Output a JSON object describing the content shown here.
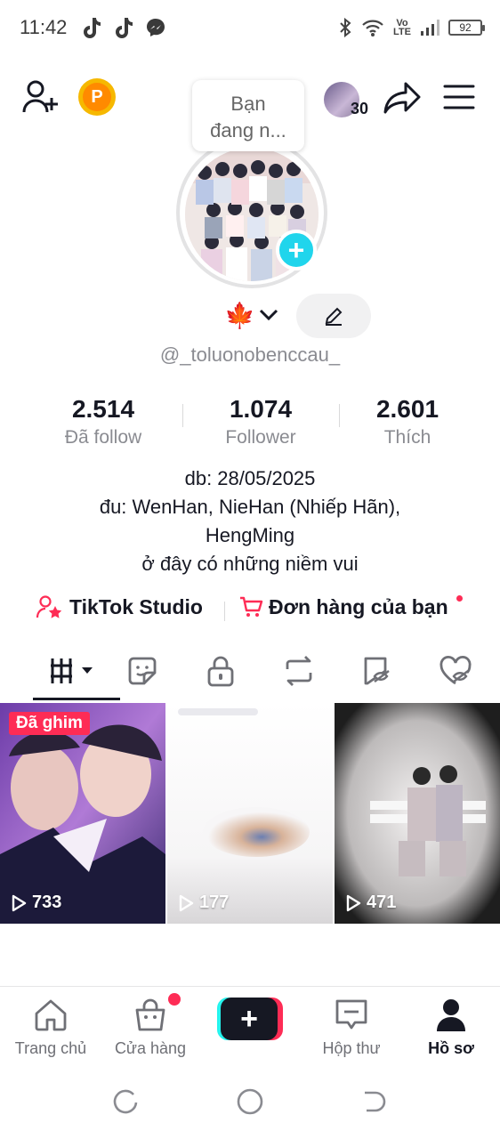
{
  "status_bar": {
    "time": "11:42",
    "left_icons": [
      "tiktok-icon",
      "tiktok-icon",
      "messenger-icon"
    ],
    "right_icons": [
      "bluetooth-icon",
      "wifi-icon",
      "volte-icon",
      "signal-icon"
    ],
    "volte_text": "Vo\nLTE",
    "battery": "92"
  },
  "header": {
    "tooltip": "Bạn\nđang n...",
    "friends_count": "30",
    "coin_letter": "P"
  },
  "profile": {
    "emoji": "🍁",
    "handle": "@_toluonobenccau_",
    "stats": [
      {
        "value": "2.514",
        "label": "Đã follow"
      },
      {
        "value": "1.074",
        "label": "Follower"
      },
      {
        "value": "2.601",
        "label": "Thích"
      }
    ],
    "bio": [
      "db: 28/05/2025",
      "đu: WenHan, NieHan (Nhiếp Hãn),",
      "HengMing",
      "ở đây có những niềm vui"
    ]
  },
  "links": {
    "studio": "TikTok Studio",
    "orders": "Đơn hàng của bạn"
  },
  "tabs": [
    "videos-grid-icon",
    "sticker-icon",
    "lock-icon",
    "repost-icon",
    "tag-hidden-icon",
    "heart-hidden-icon"
  ],
  "videos": [
    {
      "views": "733",
      "pinned_label": "Đã ghim"
    },
    {
      "views": "177"
    },
    {
      "views": "471"
    }
  ],
  "bottom_nav": {
    "home": "Trang chủ",
    "shop": "Cửa hàng",
    "inbox": "Hộp thư",
    "profile": "Hồ sơ"
  },
  "colors": {
    "accent_red": "#fe2c55",
    "accent_cyan": "#25f4ee",
    "text_primary": "#161823",
    "text_secondary": "#8a8b91"
  }
}
